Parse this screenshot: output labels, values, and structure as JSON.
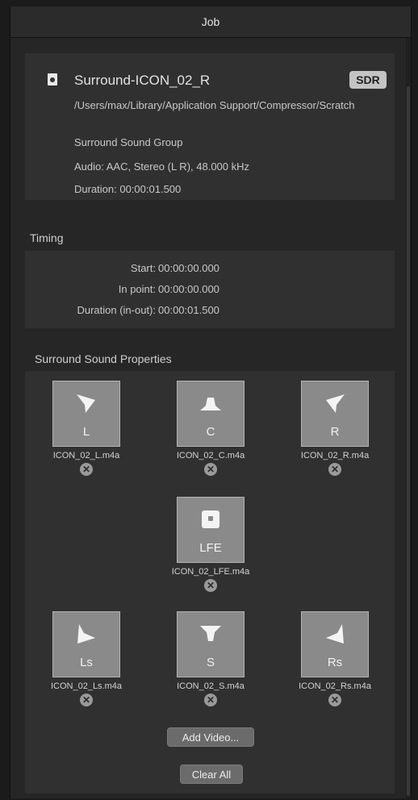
{
  "window": {
    "title": "Job"
  },
  "job": {
    "name": "Surround-ICON_02_R",
    "badge": "SDR",
    "path": "/Users/max/Library/Application Support/Compressor/Scratch",
    "group": "Surround Sound Group",
    "audio": "Audio: AAC, Stereo (L R), 48.000 kHz",
    "duration": "Duration: 00:00:01.500"
  },
  "timing": {
    "title": "Timing",
    "rows": [
      {
        "label": "Start:",
        "value": "00:00:00.000"
      },
      {
        "label": "In point:",
        "value": "00:00:00.000"
      },
      {
        "label": "Duration (in-out):",
        "value": "00:00:01.500"
      }
    ]
  },
  "surround": {
    "title": "Surround Sound Properties",
    "channels": [
      {
        "label": "L",
        "file": "ICON_02_L.m4a",
        "icon": "speaker-front-left-icon"
      },
      {
        "label": "C",
        "file": "ICON_02_C.m4a",
        "icon": "speaker-center-icon"
      },
      {
        "label": "R",
        "file": "ICON_02_R.m4a",
        "icon": "speaker-front-right-icon"
      },
      {
        "label": "LFE",
        "file": "ICON_02_LFE.m4a",
        "icon": "subwoofer-icon"
      },
      {
        "label": "Ls",
        "file": "ICON_02_Ls.m4a",
        "icon": "speaker-left-surround-icon"
      },
      {
        "label": "S",
        "file": "ICON_02_S.m4a",
        "icon": "speaker-surround-icon"
      },
      {
        "label": "Rs",
        "file": "ICON_02_Rs.m4a",
        "icon": "speaker-right-surround-icon"
      }
    ],
    "remove_glyph": "✕",
    "add_video_label": "Add Video...",
    "clear_all_label": "Clear All"
  }
}
